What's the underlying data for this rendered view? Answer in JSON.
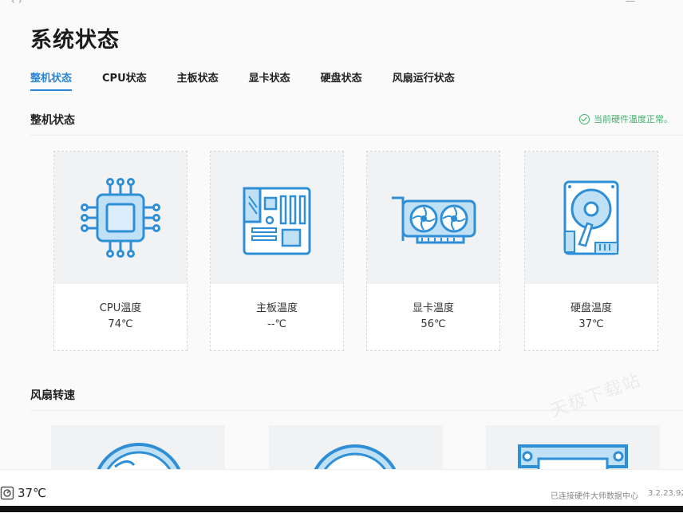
{
  "page": {
    "title": "系统状态"
  },
  "tabs": [
    {
      "label": "整机状态",
      "active": true
    },
    {
      "label": "CPU状态",
      "active": false
    },
    {
      "label": "主板状态",
      "active": false
    },
    {
      "label": "显卡状态",
      "active": false
    },
    {
      "label": "硬盘状态",
      "active": false
    },
    {
      "label": "风扇运行状态",
      "active": false
    }
  ],
  "overview": {
    "title": "整机状态",
    "status": "当前硬件温度正常。",
    "status_color": "#3db26a",
    "cards": [
      {
        "label": "CPU温度",
        "value": "74℃",
        "icon": "cpu-chip-icon"
      },
      {
        "label": "主板温度",
        "value": "--℃",
        "icon": "motherboard-icon"
      },
      {
        "label": "显卡温度",
        "value": "56℃",
        "icon": "graphics-card-icon"
      },
      {
        "label": "硬盘温度",
        "value": "37℃",
        "icon": "hard-drive-icon"
      }
    ]
  },
  "fans": {
    "title": "风扇转速",
    "cards": [
      {
        "icon": "fan-icon"
      },
      {
        "icon": "fan-icon"
      },
      {
        "icon": "case-fan-icon"
      }
    ]
  },
  "statusbar": {
    "temperature": "37℃",
    "connection": "已连接硬件大师数据中心",
    "version": "3.2.23.92"
  },
  "watermark": "天极下载站",
  "colors": {
    "accent": "#2a86d8",
    "icon_blue": "#2f8fd6",
    "icon_fill": "#bfe0f5"
  }
}
